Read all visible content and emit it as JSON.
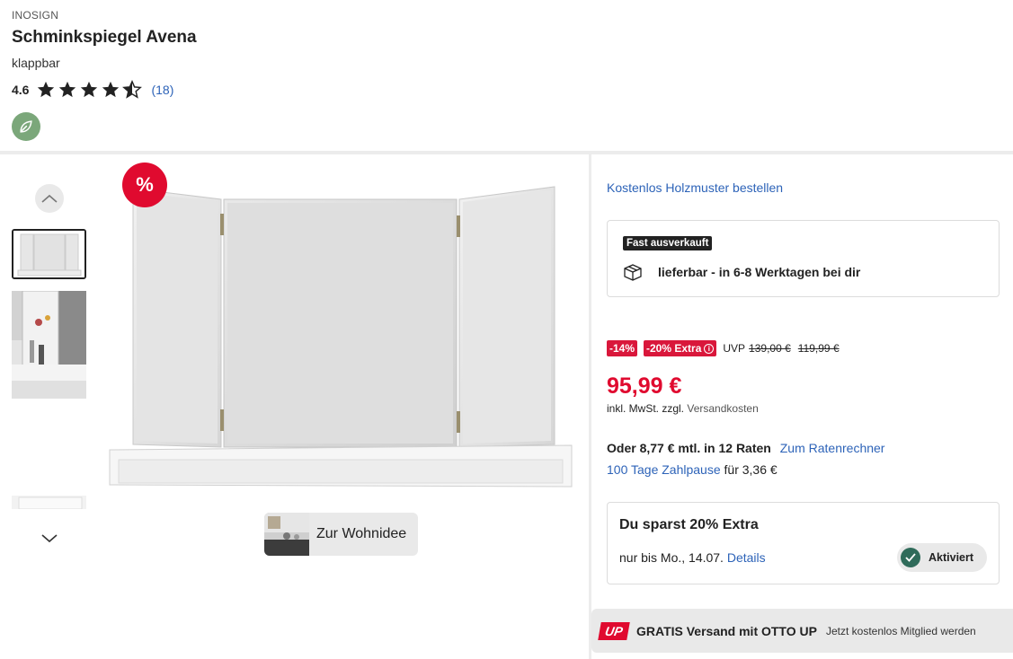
{
  "product": {
    "brand": "INOSIGN",
    "title": "Schminkspiegel Avena",
    "subtitle": "klappbar",
    "rating_value": "4.6",
    "rating_stars": 4.6,
    "rating_count": "(18)"
  },
  "gallery": {
    "sale_badge": "%",
    "wohnidee_label": "Zur Wohnidee"
  },
  "buybox": {
    "holzmuster_link": "Kostenlos Holzmuster bestellen",
    "availability_tag": "Fast ausverkauft",
    "delivery_text": "lieferbar - in 6-8 Werktagen bei dir",
    "discount_tag": "-14%",
    "extra_tag": "-20% Extra",
    "extra_info_icon": "info-icon",
    "uvp_label": "UVP",
    "uvp_price": "139,00 €",
    "old_price": "119,99 €",
    "price": "95,99 €",
    "vat_text": "inkl. MwSt. zzgl.",
    "shipping_link": "Versandkosten",
    "installment_text": "Oder 8,77 € mtl. in 12 Raten",
    "installment_link": "Zum Ratenrechner",
    "pause_link": "100 Tage Zahlpause",
    "pause_text": "für 3,36 €"
  },
  "savings": {
    "title": "Du sparst 20% Extra",
    "until_text": "nur bis Mo., 14.07.",
    "details_link": "Details",
    "status_label": "Aktiviert"
  },
  "up_banner": {
    "logo": "UP",
    "text": "GRATIS Versand mit OTTO UP",
    "sub": "Jetzt kostenlos Mitglied werden"
  },
  "colors": {
    "accent_red": "#e00a2f",
    "link_blue": "#2d63b8",
    "eco_green": "#7ba77a"
  }
}
